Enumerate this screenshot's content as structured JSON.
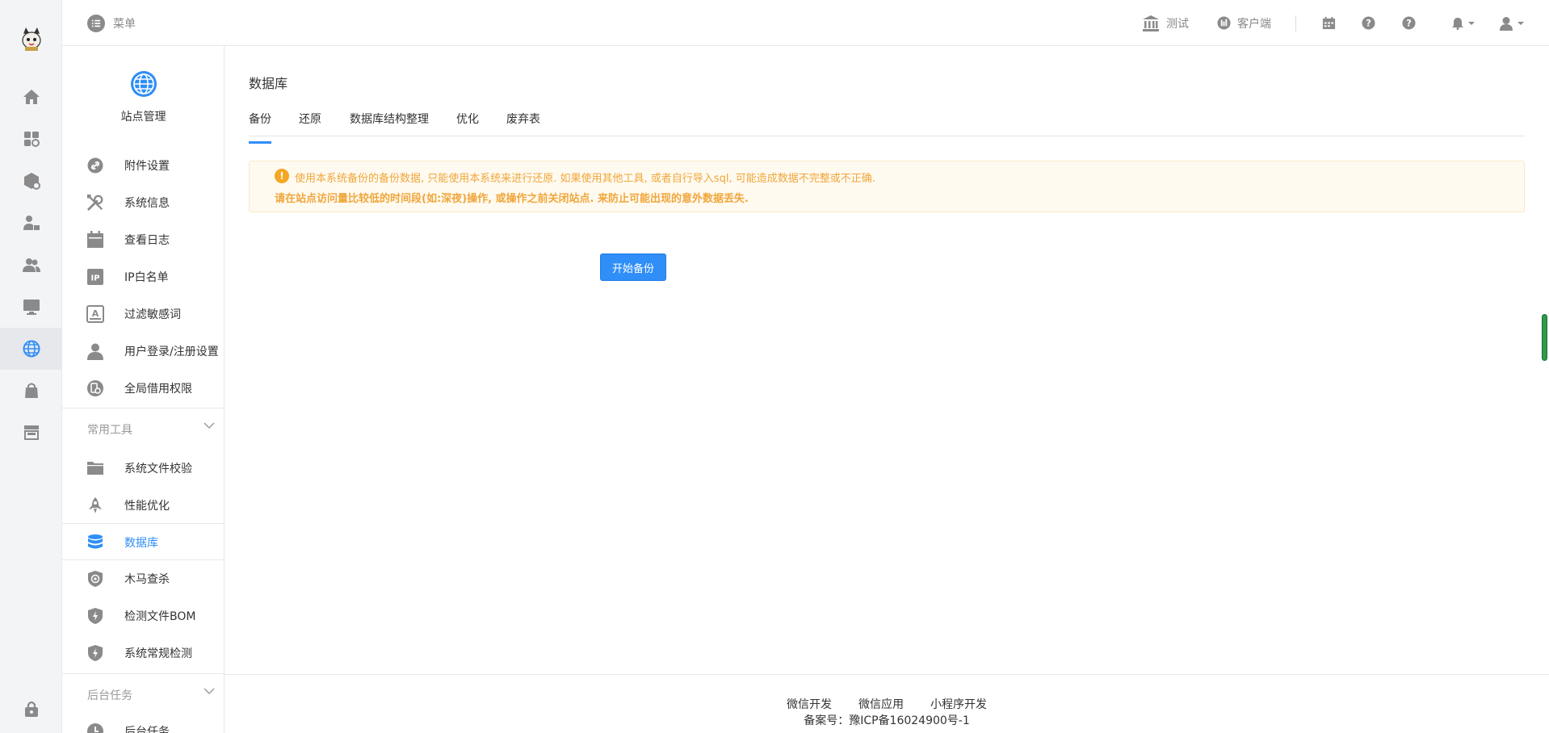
{
  "topbar": {
    "menu_label": "菜单",
    "test_label": "测试",
    "client_label": "客户端"
  },
  "sidebar": {
    "site_title": "站点管理",
    "items": [
      {
        "label": "附件设置",
        "icon": "link-icon"
      },
      {
        "label": "系统信息",
        "icon": "tools-icon"
      },
      {
        "label": "查看日志",
        "icon": "calendar-icon"
      },
      {
        "label": "IP白名单",
        "icon": "ip-icon"
      },
      {
        "label": "过滤敏感词",
        "icon": "filter-text-icon"
      },
      {
        "label": "用户登录/注册设置",
        "icon": "user-icon"
      },
      {
        "label": "全局借用权限",
        "icon": "global-permission-icon"
      }
    ],
    "group_tools": "常用工具",
    "tool_items": [
      {
        "label": "系统文件校验",
        "icon": "folder-icon"
      },
      {
        "label": "性能优化",
        "icon": "rocket-icon"
      },
      {
        "label": "数据库",
        "icon": "database-icon"
      },
      {
        "label": "木马查杀",
        "icon": "shield-scan-icon"
      },
      {
        "label": "检测文件BOM",
        "icon": "shield-bolt-icon"
      },
      {
        "label": "系统常规检测",
        "icon": "shield-bolt-icon"
      }
    ],
    "group_tasks": "后台任务",
    "task_items": [
      {
        "label": "后台任务",
        "icon": "clock-icon"
      }
    ]
  },
  "main": {
    "title": "数据库",
    "tabs": [
      "备份",
      "还原",
      "数据库结构整理",
      "优化",
      "废弃表"
    ],
    "alert_line1": "使用本系统备份的备份数据, 只能使用本系统来进行还原. 如果使用其他工具, 或者自行导入sql, 可能造成数据不完整或不正确.",
    "alert_line2": "请在站点访问量比较低的时间段(如:深夜)操作, 或操作之前关闭站点. 来防止可能出现的意外数据丢失.",
    "start_button": "开始备份"
  },
  "footer": {
    "links": [
      "微信开发",
      "微信应用",
      "小程序开发"
    ],
    "icp": "备案号：豫ICP备16024900号-1"
  },
  "colors": {
    "accent": "#2f8ef7",
    "warning": "#f0a63a",
    "icon_gray": "#8a8a8a"
  }
}
